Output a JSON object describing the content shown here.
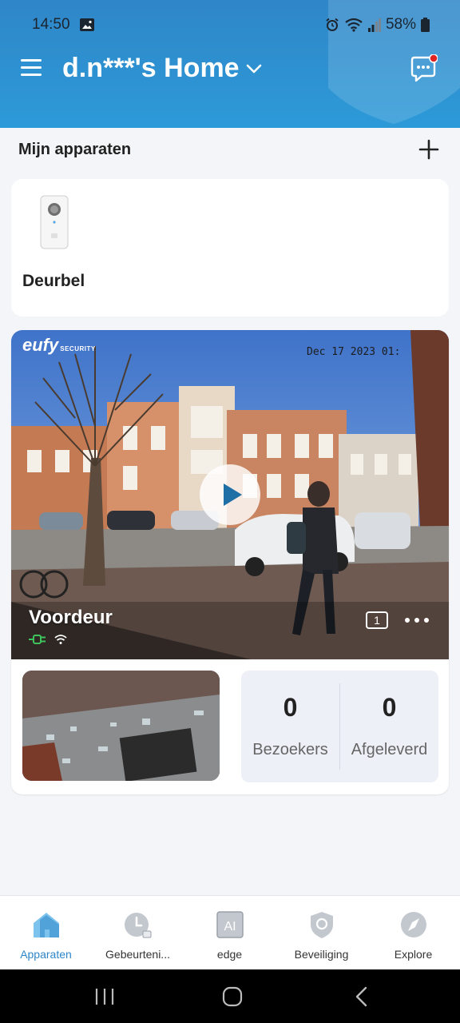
{
  "status_bar": {
    "time": "14:50",
    "battery": "58%"
  },
  "header": {
    "home_name": "d.n***'s Home"
  },
  "devices_section": {
    "title": "Mijn apparaten"
  },
  "device": {
    "name": "Deurbel"
  },
  "camera": {
    "brand": "eufy",
    "brand_sub": "SECURITY",
    "timestamp": "Dec 17 2023 01:",
    "name": "Voordeur",
    "clip_count": "1"
  },
  "stats": [
    {
      "value": "0",
      "label": "Bezoekers"
    },
    {
      "value": "0",
      "label": "Afgeleverd"
    }
  ],
  "bottom_nav": [
    {
      "label": "Apparaten",
      "icon": "home-icon",
      "active": true
    },
    {
      "label": "Gebeurteni...",
      "icon": "clock-icon",
      "active": false
    },
    {
      "label": "edge",
      "icon": "ai-icon",
      "active": false
    },
    {
      "label": "Beveiliging",
      "icon": "shield-icon",
      "active": false
    },
    {
      "label": "Explore",
      "icon": "compass-icon",
      "active": false
    }
  ],
  "colors": {
    "header": "#2d8fd0",
    "accent": "#2e86c8",
    "background": "#f4f5f9"
  }
}
